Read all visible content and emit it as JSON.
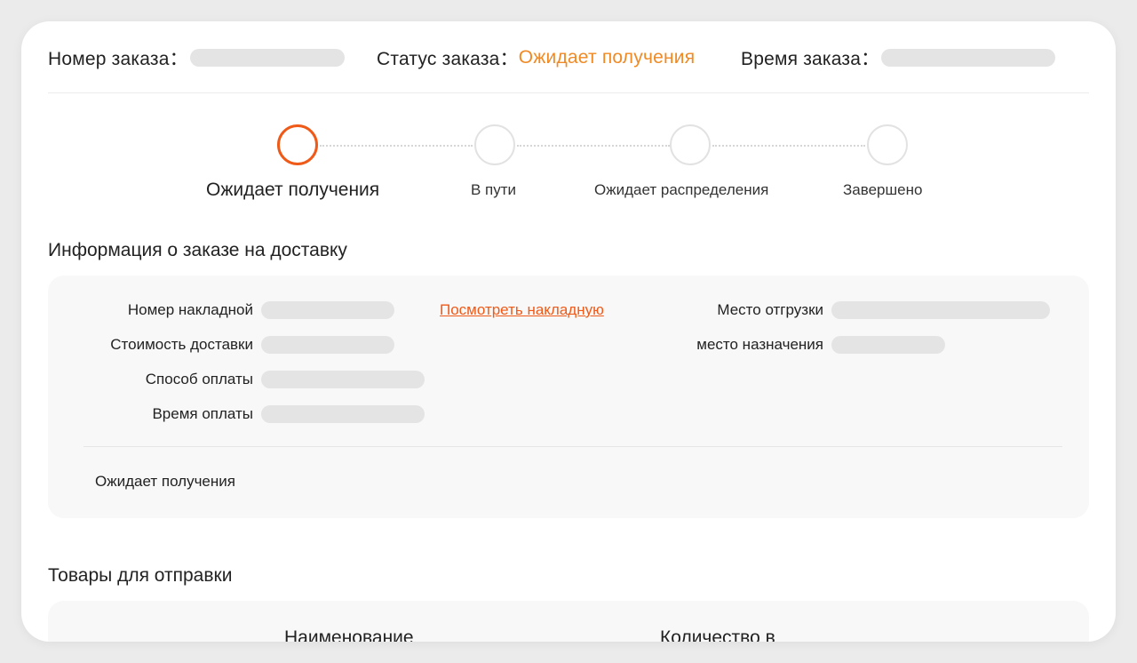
{
  "header": {
    "order_number_label": "Номер заказа：",
    "order_status_label": "Статус заказа：",
    "order_status_value": "Ожидает получения",
    "order_time_label": "Время заказа："
  },
  "steps": [
    {
      "label": "Ожидает получения",
      "active": true
    },
    {
      "label": "В пути",
      "active": false
    },
    {
      "label": "Ожидает распределения",
      "active": false
    },
    {
      "label": "Завершено",
      "active": false
    }
  ],
  "shipping_info": {
    "title": "Информация о заказе на доставку",
    "waybill_number_label": "Номер накладной",
    "view_waybill_link": "Посмотреть накладную",
    "shipping_place_label": "Место отгрузки",
    "delivery_cost_label": "Стоимость доставки",
    "destination_label": "место назначения",
    "payment_method_label": "Способ оплаты",
    "payment_time_label": "Время оплаты",
    "status_note": "Ожидает получения"
  },
  "goods": {
    "title": "Товары для отправки",
    "columns": [
      "Наименование",
      "Количество в"
    ]
  },
  "colors": {
    "accent": "#ef5a18",
    "status_orange": "#f08a24",
    "placeholder_pill": "#e4e4e4"
  }
}
